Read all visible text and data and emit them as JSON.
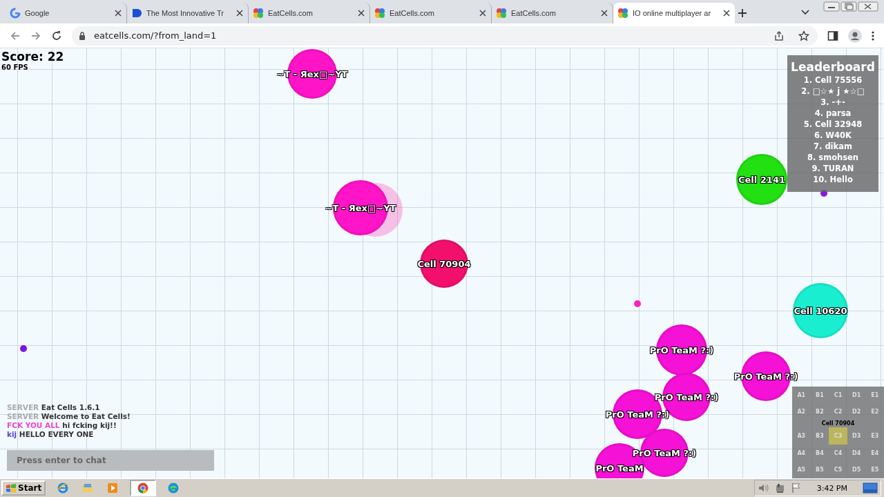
{
  "browser": {
    "tabs": [
      {
        "title": "Google",
        "kind": "google",
        "selected": false
      },
      {
        "title": "The Most Innovative Tr",
        "kind": "blue",
        "selected": false
      },
      {
        "title": "EatCells.com",
        "kind": "eatcells",
        "selected": false
      },
      {
        "title": "EatCells.com",
        "kind": "eatcells",
        "selected": false
      },
      {
        "title": "EatCells.com",
        "kind": "eatcells",
        "selected": false
      },
      {
        "title": "IO online multiplayer ar",
        "kind": "eatcells",
        "selected": true
      }
    ],
    "address": "eatcells.com/?from_land=1"
  },
  "game": {
    "score": "Score: 22",
    "fps": "60 FPS",
    "cells": [
      {
        "name": "~T - Яex□~YT",
        "color": "#ff14c8"
      },
      {
        "name": "~T - Яex□~YT",
        "color": "#ff14c8"
      },
      {
        "name": "Cell 70904",
        "color": "#f3106c"
      },
      {
        "name": "Cell 2141",
        "color": "#22e011"
      },
      {
        "name": "Cell 10620",
        "color": "#19efd0"
      },
      {
        "name": "PrO TeaM ?:)",
        "color": "#f511d6"
      },
      {
        "name": "PrO TeaM ?:)",
        "color": "#f511d6"
      },
      {
        "name": "PrO TeaM ?:)",
        "color": "#f511d6"
      },
      {
        "name": "PrO TeaM ?:)",
        "color": "#f511d6"
      },
      {
        "name": "PrO TeaM ?:)",
        "color": "#f511d6"
      },
      {
        "name": "PrO TeaM",
        "color": "#f511d6"
      }
    ],
    "leaderboard": {
      "title": "Leaderboard",
      "entries": [
        "1. Cell 75556",
        "2. □☆★ j ★☆□",
        "3. -+-",
        "4. parsa",
        "5. Cell 32948",
        "6. W40K",
        "7. dikam",
        "8. smohsen",
        "9. TURAN",
        "10. Hello"
      ]
    },
    "chat": {
      "messages": [
        {
          "sender": "SERVER",
          "text": "Eat Cells 1.6.1",
          "color": "#aaaaaa"
        },
        {
          "sender": "SERVER",
          "text": "Welcome to Eat Cells!",
          "color": "#aaaaaa"
        },
        {
          "sender": "FCK YOU ALL",
          "text": "hi fcking kij!!",
          "color": "#ee44cc"
        },
        {
          "sender": "kij",
          "text": "HELLO EVERY ONE",
          "color": "#5544dd"
        }
      ],
      "placeholder": "Press enter to chat"
    },
    "minimap": {
      "player": "Cell 70904",
      "sectors": [
        {
          "label": "A1",
          "selected": false
        },
        {
          "label": "B1",
          "selected": false
        },
        {
          "label": "C1",
          "selected": false
        },
        {
          "label": "D1",
          "selected": false
        },
        {
          "label": "E1",
          "selected": false
        },
        {
          "label": "A2",
          "selected": false
        },
        {
          "label": "B2",
          "selected": false
        },
        {
          "label": "C2",
          "selected": false
        },
        {
          "label": "D2",
          "selected": false
        },
        {
          "label": "E2",
          "selected": false
        },
        {
          "label": "A3",
          "selected": false
        },
        {
          "label": "B3",
          "selected": false
        },
        {
          "label": "C3",
          "selected": true
        },
        {
          "label": "D3",
          "selected": false
        },
        {
          "label": "E3",
          "selected": false
        },
        {
          "label": "A4",
          "selected": false
        },
        {
          "label": "B4",
          "selected": false
        },
        {
          "label": "C4",
          "selected": false
        },
        {
          "label": "D4",
          "selected": false
        },
        {
          "label": "E4",
          "selected": false
        },
        {
          "label": "A5",
          "selected": false
        },
        {
          "label": "B5",
          "selected": false
        },
        {
          "label": "C5",
          "selected": false
        },
        {
          "label": "D5",
          "selected": false
        },
        {
          "label": "E5",
          "selected": false
        }
      ]
    }
  },
  "taskbar": {
    "start": "Start",
    "clock": "3:42 PM"
  }
}
